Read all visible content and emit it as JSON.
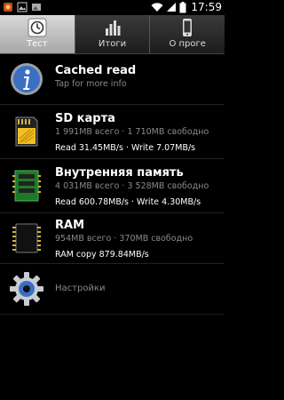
{
  "status_bar": {
    "time": "17:59",
    "left_icons": [
      "app-notification-icon",
      "image-notification-icon",
      "gallery-notification-icon"
    ],
    "right_icons": [
      "wifi-icon",
      "signal-icon",
      "battery-icon"
    ]
  },
  "tabs": [
    {
      "label": "Тест",
      "icon": "gauge-icon",
      "active": true
    },
    {
      "label": "Итоги",
      "icon": "bar-chart-icon",
      "active": false
    },
    {
      "label": "О проге",
      "icon": "phone-icon",
      "active": false
    }
  ],
  "items": {
    "cached_read": {
      "title": "Cached read",
      "subtitle": "Tap for more info",
      "icon": "info-icon"
    },
    "sd_card": {
      "title": "SD карта",
      "subtitle": "1 991MB всего · 1 710MB свободно",
      "speed": "Read 31.45MB/s · Write 7.07MB/s",
      "icon": "sd-card-icon"
    },
    "internal": {
      "title": "Внутренняя память",
      "subtitle": "4 031MB всего · 3 528MB свободно",
      "speed": "Read 600.78MB/s · Write 4.30MB/s",
      "icon": "memory-module-icon"
    },
    "ram": {
      "title": "RAM",
      "subtitle": "954MB всего · 370MB свободно",
      "speed": "RAM copy 879.84MB/s",
      "icon": "chip-icon"
    },
    "settings": {
      "title": "Настройки",
      "icon": "gear-icon"
    }
  },
  "colors": {
    "background": "#000000",
    "secondary_text": "#8a8a8a",
    "info_blue": "#3b6fc4",
    "tab_active": "#c8c8c8"
  }
}
